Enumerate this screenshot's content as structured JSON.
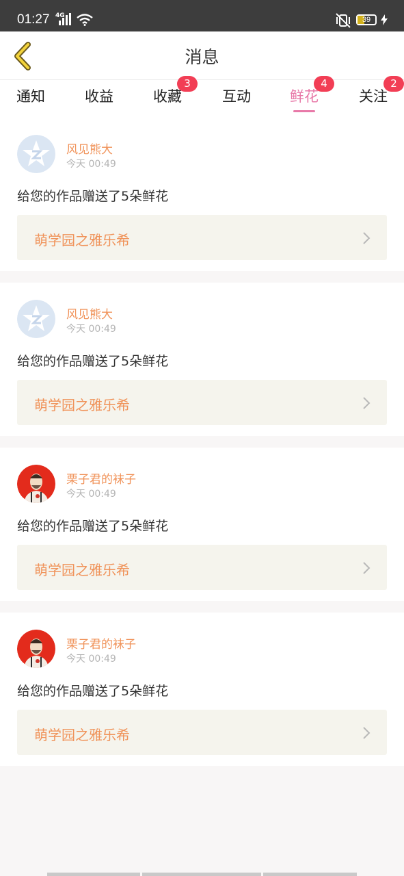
{
  "status_bar": {
    "time": "01:27",
    "network": "4G",
    "battery": "39",
    "battery_level": 0.39,
    "icons": [
      "signal-icon",
      "wifi-icon",
      "vibrate-off-icon",
      "battery-icon",
      "charging-icon"
    ]
  },
  "header": {
    "title": "消息",
    "back_icon": "chevron-left-icon"
  },
  "tabs": [
    {
      "label": "通知",
      "badge": "",
      "active": false
    },
    {
      "label": "收益",
      "badge": "",
      "active": false
    },
    {
      "label": "收藏",
      "badge": "3",
      "active": false
    },
    {
      "label": "互动",
      "badge": "",
      "active": false
    },
    {
      "label": "鲜花",
      "badge": "4",
      "active": true
    },
    {
      "label": "关注",
      "badge": "2",
      "active": false
    }
  ],
  "messages": [
    {
      "user": "风见熊大",
      "time": "今天 00:49",
      "text": "给您的作品赠送了5朵鲜花",
      "work": "萌学园之雅乐希",
      "avatar": "default-avatar-icon"
    },
    {
      "user": "风见熊大",
      "time": "今天 00:49",
      "text": "给您的作品赠送了5朵鲜花",
      "work": "萌学园之雅乐希",
      "avatar": "default-avatar-icon"
    },
    {
      "user": "栗子君的袜子",
      "time": "今天 00:49",
      "text": "给您的作品赠送了5朵鲜花",
      "work": "萌学园之雅乐希",
      "avatar": "character-avatar"
    },
    {
      "user": "栗子君的袜子",
      "time": "今天 00:49",
      "text": "给您的作品赠送了5朵鲜花",
      "work": "萌学园之雅乐希",
      "avatar": "character-avatar"
    }
  ],
  "colors": {
    "accent": "#e879a8",
    "username": "#f0935a",
    "badge": "#f23e55",
    "back_icon": "#e8c62e",
    "status_bar": "#3d3d3d"
  }
}
